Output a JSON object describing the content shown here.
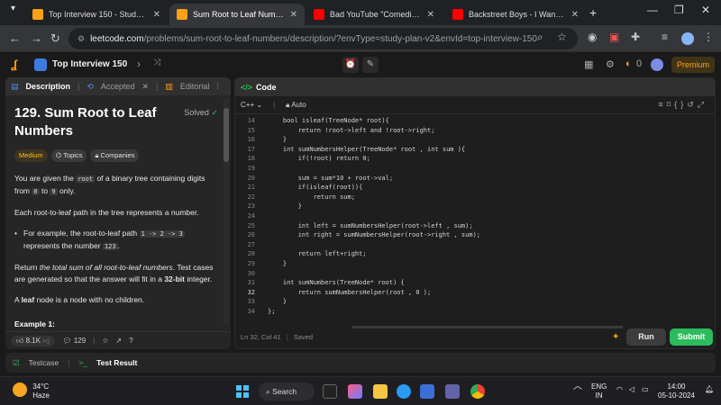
{
  "browser": {
    "tabs": [
      {
        "title": "Top Interview 150 - Study Plan - Le",
        "color": "#ffa116"
      },
      {
        "title": "Sum Root to Leaf Numbers - Leetc",
        "color": "#ffa116"
      },
      {
        "title": "Bad YouTube \"Comedians\" (M",
        "color": "#ff0000"
      },
      {
        "title": "Backstreet Boys - I Want It That W",
        "color": "#ff0000"
      }
    ],
    "close_glyph": "✕",
    "new_tab": "+",
    "url_host": "leetcode.com",
    "url_path": "/problems/sum-root-to-leaf-numbers/description/?envType=study-plan-v2&envId=top-interview-150"
  },
  "lc_header": {
    "list_name": "Top Interview 150",
    "notifications": "0",
    "premium": "Premium"
  },
  "description": {
    "tabs": [
      "Description",
      "Accepted",
      "Editorial"
    ],
    "title": "129. Sum Root to Leaf Numbers",
    "solved": "Solved",
    "tags": [
      "Medium",
      "Topics",
      "Companies"
    ],
    "p1_a": "You are given the ",
    "p1_code1": "root",
    "p1_b": " of a binary tree containing digits from ",
    "p1_code2": "0",
    "p1_c": " to ",
    "p1_code3": "9",
    "p1_d": " only.",
    "p2": "Each root-to-leaf path in the tree represents a number.",
    "p3_a": "For example, the root-to-leaf path ",
    "p3_code1": "1 -> 2 -> 3",
    "p3_b": " represents the number ",
    "p3_code2": "123",
    "p3_c": ".",
    "p4_a": "Return ",
    "p4_em": "the total sum of all root-to-leaf numbers",
    "p4_b": ". Test cases are generated so that the answer will fit in a ",
    "p4_strong": "32-bit",
    "p4_c": " integer.",
    "p5_a": "A ",
    "p5_strong": "leaf",
    "p5_b": " node is a node with no children.",
    "example": "Example 1:",
    "likes": "8.1K",
    "comments": "129"
  },
  "code": {
    "header": "Code",
    "language": "C++",
    "mode": "Auto",
    "status": "Ln 32, Col 41",
    "saved": "Saved",
    "lines": [
      {
        "n": "14",
        "t": "    bool isleaf(TreeNode* root){"
      },
      {
        "n": "15",
        "t": "        return !root->left and !root->right;"
      },
      {
        "n": "16",
        "t": "    }"
      },
      {
        "n": "17",
        "t": "    int sumNumbersHelper(TreeNode* root , int sum ){"
      },
      {
        "n": "18",
        "t": "        if(!root) return 0;"
      },
      {
        "n": "19",
        "t": ""
      },
      {
        "n": "20",
        "t": "        sum = sum*10 + root->val;"
      },
      {
        "n": "21",
        "t": "        if(isleaf(root)){"
      },
      {
        "n": "22",
        "t": "            return sum;"
      },
      {
        "n": "23",
        "t": "        }"
      },
      {
        "n": "24",
        "t": ""
      },
      {
        "n": "25",
        "t": "        int left = sumNumbersHelper(root->left , sum);"
      },
      {
        "n": "26",
        "t": "        int right = sumNumbersHelper(root->right , sum);"
      },
      {
        "n": "27",
        "t": ""
      },
      {
        "n": "28",
        "t": "        return left+right;"
      },
      {
        "n": "29",
        "t": "    }"
      },
      {
        "n": "30",
        "t": ""
      },
      {
        "n": "31",
        "t": "    int sumNumbers(TreeNode* root) {"
      },
      {
        "n": "32",
        "t": "        return sumNumbersHelper(root , 0 );"
      },
      {
        "n": "33",
        "t": "    }"
      },
      {
        "n": "34",
        "t": "};"
      }
    ],
    "run": "Run",
    "submit": "Submit"
  },
  "testbar": {
    "testcase": "Testcase",
    "result": "Test Result"
  },
  "taskbar": {
    "temp": "34°C",
    "weather": "Haze",
    "search": "Search",
    "lang1": "ENG",
    "lang2": "IN",
    "time": "14:00",
    "date": "05-10-2024"
  }
}
